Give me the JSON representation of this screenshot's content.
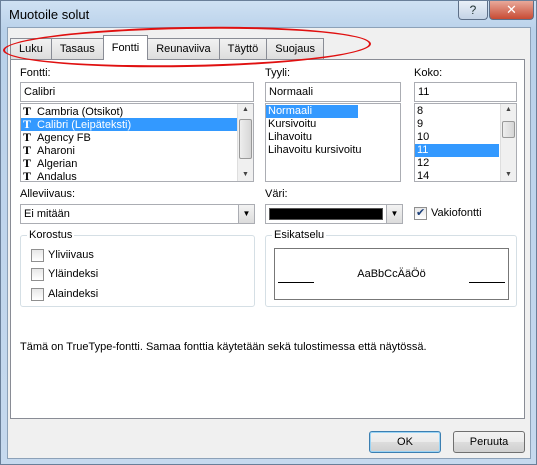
{
  "window": {
    "title": "Muotoile solut",
    "help_glyph": "?",
    "close_glyph": "✕"
  },
  "tabs": [
    {
      "label": "Luku",
      "active": false
    },
    {
      "label": "Tasaus",
      "active": false
    },
    {
      "label": "Fontti",
      "active": true
    },
    {
      "label": "Reunaviiva",
      "active": false
    },
    {
      "label": "Täyttö",
      "active": false
    },
    {
      "label": "Suojaus",
      "active": false
    }
  ],
  "font": {
    "label": "Fontti:",
    "value": "Calibri",
    "icon": "truetype-font-icon",
    "items": [
      {
        "label": "Cambria (Otsikot)",
        "selected": false
      },
      {
        "label": "Calibri (Leipäteksti)",
        "selected": true
      },
      {
        "label": "Agency FB",
        "selected": false
      },
      {
        "label": "Aharoni",
        "selected": false
      },
      {
        "label": "Algerian",
        "selected": false
      },
      {
        "label": "Andalus",
        "selected": false
      }
    ]
  },
  "style": {
    "label": "Tyyli:",
    "value": "Normaali",
    "items": [
      {
        "label": "Normaali",
        "selected": true
      },
      {
        "label": "Kursivoitu",
        "selected": false
      },
      {
        "label": "Lihavoitu",
        "selected": false
      },
      {
        "label": "Lihavoitu kursivoitu",
        "selected": false
      }
    ]
  },
  "size": {
    "label": "Koko:",
    "value": "11",
    "items": [
      {
        "label": "8",
        "selected": false
      },
      {
        "label": "9",
        "selected": false
      },
      {
        "label": "10",
        "selected": false
      },
      {
        "label": "11",
        "selected": true
      },
      {
        "label": "12",
        "selected": false
      },
      {
        "label": "14",
        "selected": false
      }
    ]
  },
  "underline": {
    "label": "Alleviivaus:",
    "value": "Ei mitään"
  },
  "color": {
    "label": "Väri:",
    "swatch": "#000000",
    "normal_font_label": "Vakiofontti",
    "normal_font_checked": true
  },
  "effects": {
    "title": "Korostus",
    "items": [
      {
        "label": "Yliviivaus",
        "checked": false
      },
      {
        "label": "Yläindeksi",
        "checked": false
      },
      {
        "label": "Alaindeksi",
        "checked": false
      }
    ]
  },
  "preview": {
    "title": "Esikatselu",
    "sample": "AaBbCcÄäÖö"
  },
  "info": "Tämä on TrueType-fontti. Samaa fonttia käytetään sekä tulostimessa että näytössä.",
  "buttons": {
    "ok": "OK",
    "cancel": "Peruuta"
  },
  "annotation_color": "#e01010"
}
